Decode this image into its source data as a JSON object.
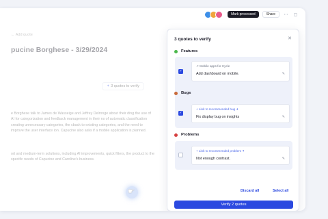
{
  "topbar": {
    "avatars": [
      "#3d8fe8",
      "#f0a43c",
      "#e85a8a"
    ],
    "mark_processed": "Mark processed",
    "share": "Share"
  },
  "doc": {
    "breadcrumb": "← Add quote",
    "title": "pucine Borghese - 3/29/2024",
    "verify_pill": "3 quotes to verify",
    "paragraph_1": "e Borghese talk to James de Wasseige and Jeffrey Delronge about their ding the use of AI for categorization and feedback management in their ns of automatic classification creating unnecessary categories, the cback to existing categories, and the need to improve the user interface ion. Capucine also asks if a mobile application is planned.",
    "paragraph_2": "ort and medium-term solutions, including AI improvements, quick filters, the product to the specific needs of Capucine and Caroline's business."
  },
  "panel": {
    "title": "3 quotes to verify",
    "sections": [
      {
        "heading": "Features",
        "color": "#4cb84c",
        "link": "Mobile apps for Cycle",
        "link_style": "gray",
        "quote": "Add dashboard on mobile.",
        "checked": true
      },
      {
        "heading": "Bugs",
        "color": "#c86a3a",
        "link": "Link to recommended bug ✦",
        "link_style": "blue",
        "quote": "Fix display bug on insights",
        "checked": true
      },
      {
        "heading": "Problems",
        "color": "#d64040",
        "link": "Link to recommended problem ✦",
        "link_style": "blue",
        "quote": "Not enough contrast.",
        "checked": false
      }
    ],
    "discard_all": "Discard all",
    "select_all": "Select all",
    "verify_button": "Verify 2 quotes"
  }
}
